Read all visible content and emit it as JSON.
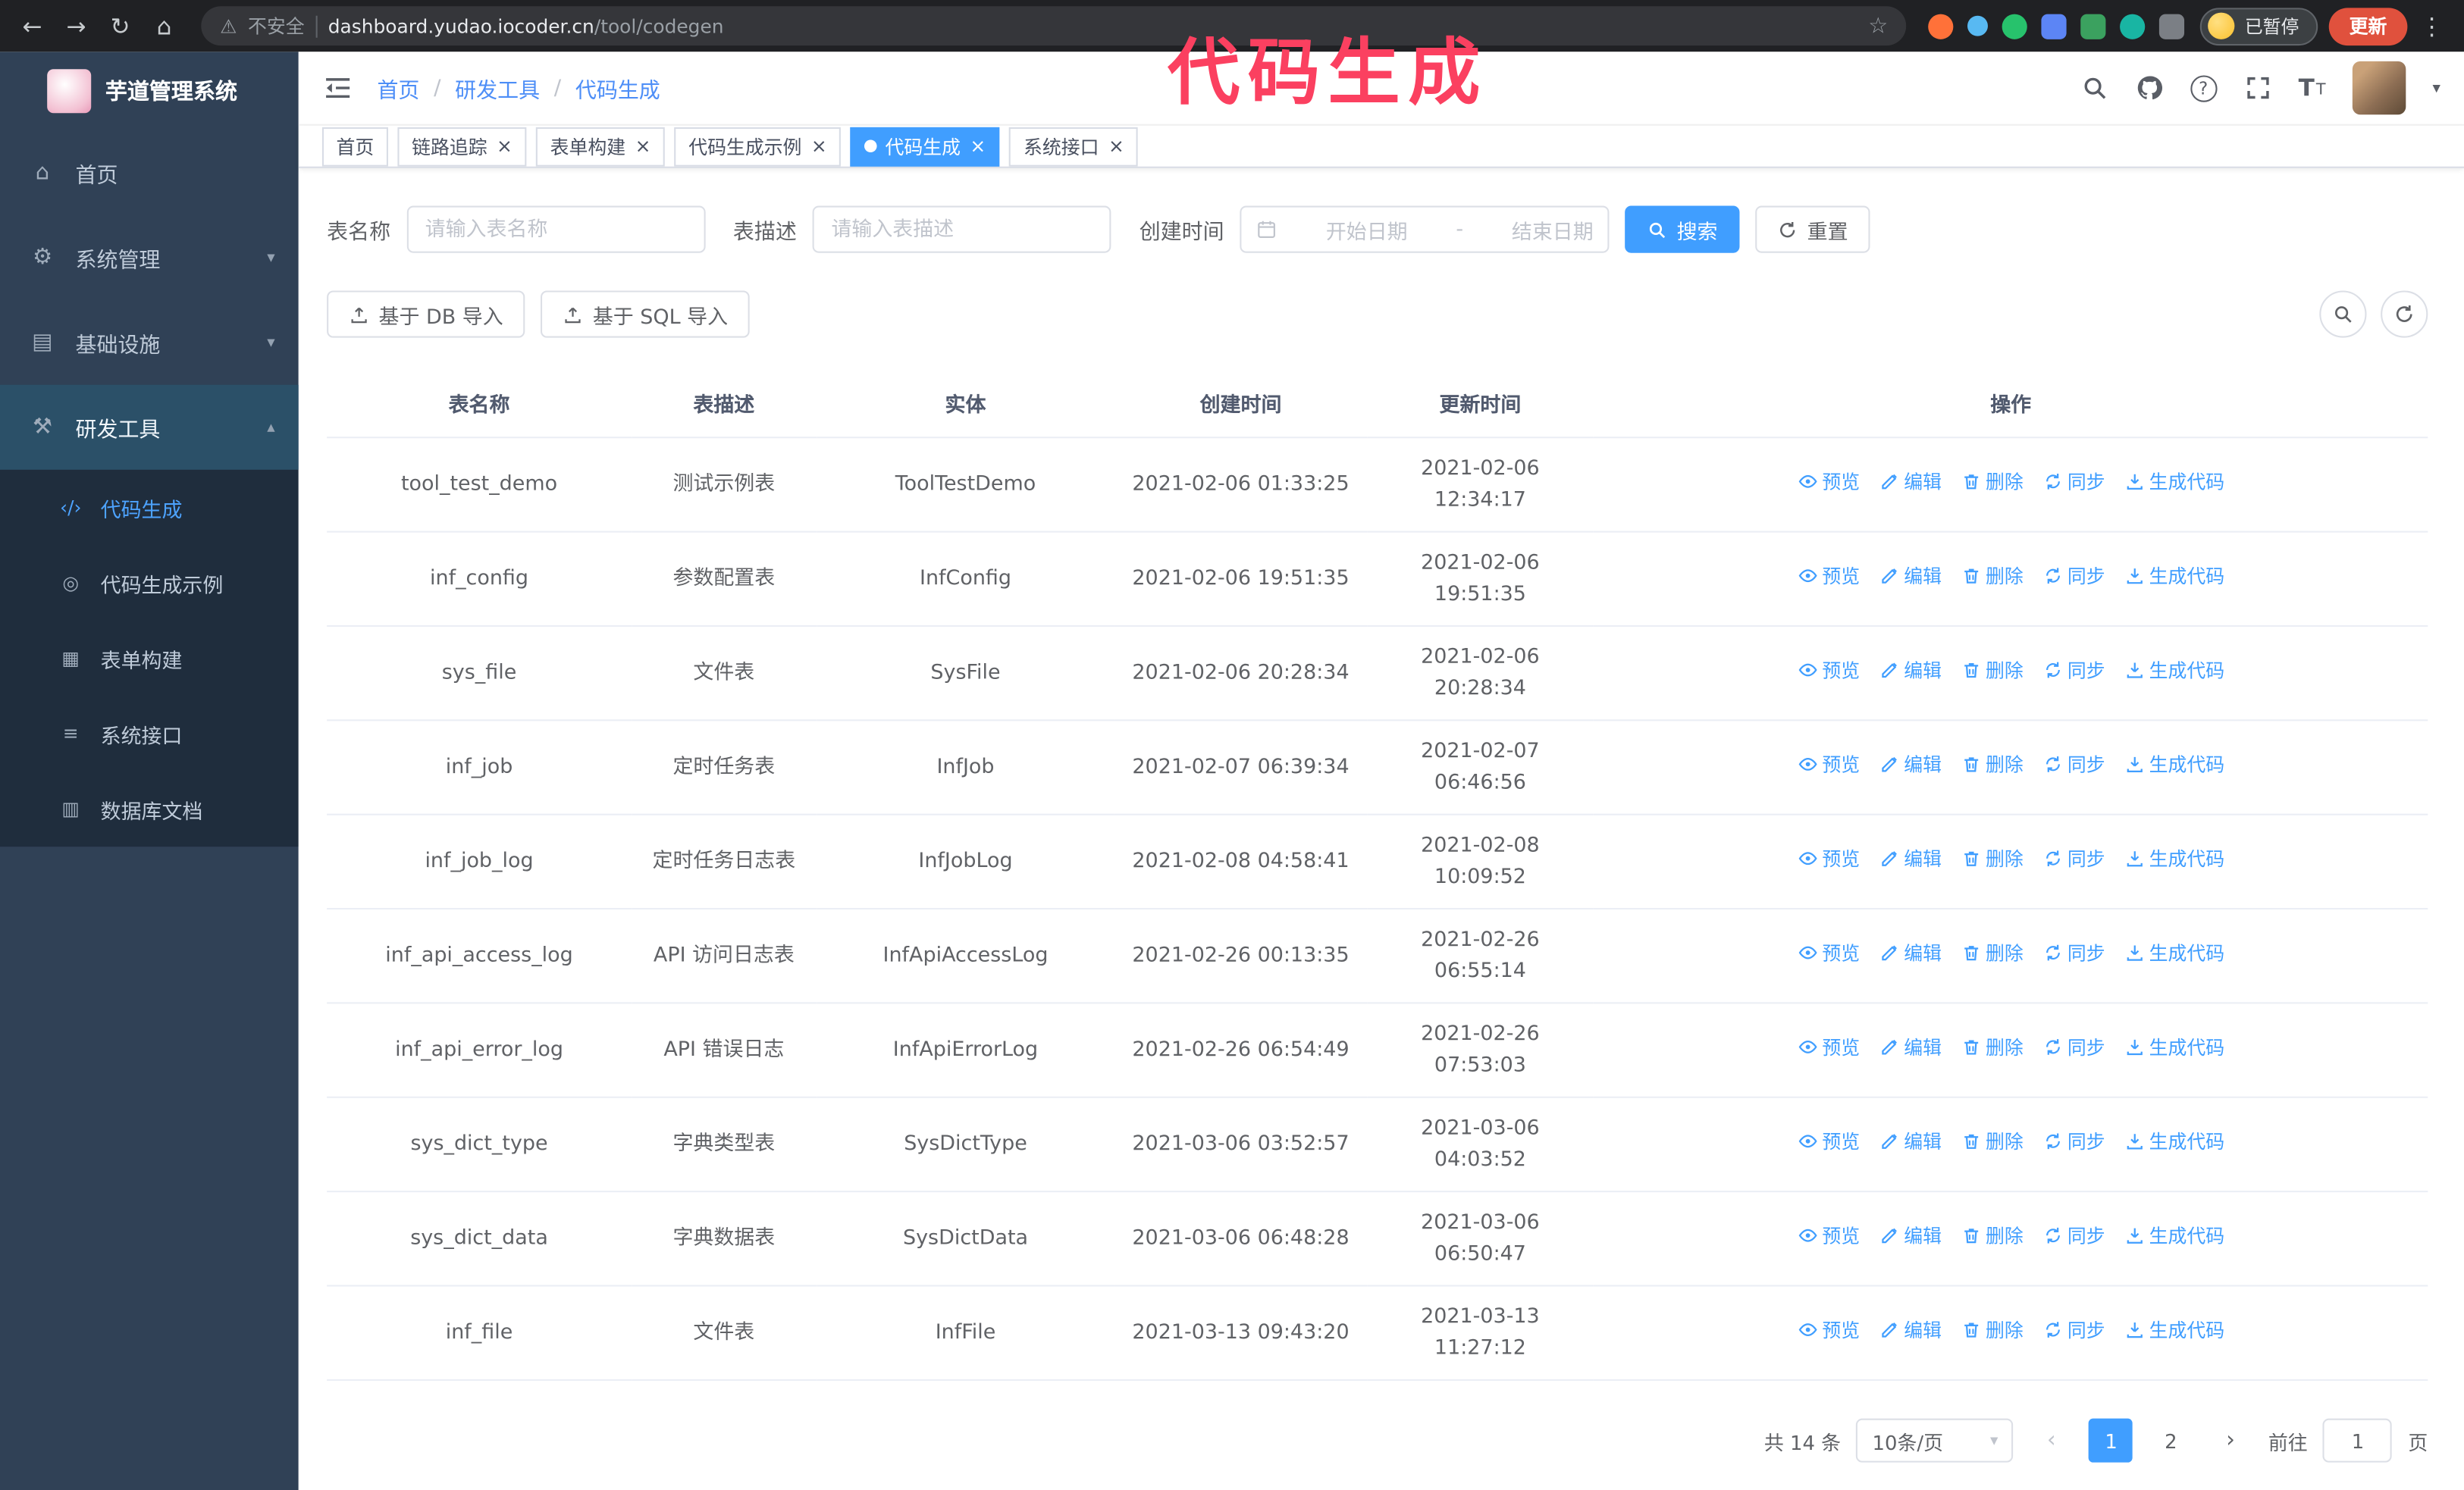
{
  "browser": {
    "security_label": "不安全",
    "url_host": "dashboard.yudao.iocoder.cn",
    "url_path": "/tool/codegen",
    "paused_badge": "已暂停",
    "update_button": "更新"
  },
  "annotation": {
    "text": "代码生成"
  },
  "sidebar": {
    "logo_title": "芋道管理系统",
    "items": [
      {
        "key": "home",
        "label": "首页",
        "icon": "dashboard",
        "expandable": false,
        "expanded": false
      },
      {
        "key": "system",
        "label": "系统管理",
        "icon": "gear",
        "expandable": true,
        "expanded": false
      },
      {
        "key": "infra",
        "label": "基础设施",
        "icon": "server",
        "expandable": true,
        "expanded": false
      },
      {
        "key": "devtools",
        "label": "研发工具",
        "icon": "tool",
        "expandable": true,
        "expanded": true
      }
    ],
    "sub_items": [
      {
        "key": "codegen",
        "label": "代码生成",
        "icon": "code",
        "active": true
      },
      {
        "key": "codegen-example",
        "label": "代码生成示例",
        "icon": "example",
        "active": false
      },
      {
        "key": "form-builder",
        "label": "表单构建",
        "icon": "form",
        "active": false
      },
      {
        "key": "api",
        "label": "系统接口",
        "icon": "api",
        "active": false
      },
      {
        "key": "db-doc",
        "label": "数据库文档",
        "icon": "db",
        "active": false
      }
    ]
  },
  "header": {
    "breadcrumb": [
      "首页",
      "研发工具",
      "代码生成"
    ],
    "separator": "/"
  },
  "tabs": [
    {
      "label": "首页",
      "closable": false,
      "active": false
    },
    {
      "label": "链路追踪",
      "closable": true,
      "active": false
    },
    {
      "label": "表单构建",
      "closable": true,
      "active": false
    },
    {
      "label": "代码生成示例",
      "closable": true,
      "active": false
    },
    {
      "label": "代码生成",
      "closable": true,
      "active": true
    },
    {
      "label": "系统接口",
      "closable": true,
      "active": false
    }
  ],
  "filters": {
    "table_name_label": "表名称",
    "table_name_placeholder": "请输入表名称",
    "table_desc_label": "表描述",
    "table_desc_placeholder": "请输入表描述",
    "create_time_label": "创建时间",
    "date_start_placeholder": "开始日期",
    "date_separator": "-",
    "date_end_placeholder": "结束日期",
    "search_button": "搜索",
    "reset_button": "重置"
  },
  "toolbar": {
    "import_db": "基于 DB 导入",
    "import_sql": "基于 SQL 导入"
  },
  "table": {
    "columns": [
      "表名称",
      "表描述",
      "实体",
      "创建时间",
      "更新时间",
      "操作"
    ],
    "actions": [
      "预览",
      "编辑",
      "删除",
      "同步",
      "生成代码"
    ],
    "rows": [
      {
        "name": "tool_test_demo",
        "desc": "测试示例表",
        "entity": "ToolTestDemo",
        "created": "2021-02-06 01:33:25",
        "updated": "2021-02-06 12:34:17"
      },
      {
        "name": "inf_config",
        "desc": "参数配置表",
        "entity": "InfConfig",
        "created": "2021-02-06 19:51:35",
        "updated": "2021-02-06 19:51:35"
      },
      {
        "name": "sys_file",
        "desc": "文件表",
        "entity": "SysFile",
        "created": "2021-02-06 20:28:34",
        "updated": "2021-02-06 20:28:34"
      },
      {
        "name": "inf_job",
        "desc": "定时任务表",
        "entity": "InfJob",
        "created": "2021-02-07 06:39:34",
        "updated": "2021-02-07 06:46:56"
      },
      {
        "name": "inf_job_log",
        "desc": "定时任务日志表",
        "entity": "InfJobLog",
        "created": "2021-02-08 04:58:41",
        "updated": "2021-02-08 10:09:52"
      },
      {
        "name": "inf_api_access_log",
        "desc": "API 访问日志表",
        "entity": "InfApiAccessLog",
        "created": "2021-02-26 00:13:35",
        "updated": "2021-02-26 06:55:14"
      },
      {
        "name": "inf_api_error_log",
        "desc": "API 错误日志",
        "entity": "InfApiErrorLog",
        "created": "2021-02-26 06:54:49",
        "updated": "2021-02-26 07:53:03"
      },
      {
        "name": "sys_dict_type",
        "desc": "字典类型表",
        "entity": "SysDictType",
        "created": "2021-03-06 03:52:57",
        "updated": "2021-03-06 04:03:52"
      },
      {
        "name": "sys_dict_data",
        "desc": "字典数据表",
        "entity": "SysDictData",
        "created": "2021-03-06 06:48:28",
        "updated": "2021-03-06 06:50:47"
      },
      {
        "name": "inf_file",
        "desc": "文件表",
        "entity": "InfFile",
        "created": "2021-03-13 09:43:20",
        "updated": "2021-03-13 11:27:12"
      }
    ]
  },
  "pagination": {
    "total": "共 14 条",
    "page_size": "10条/页",
    "pages": [
      "1",
      "2"
    ],
    "active_page": "1",
    "goto_label": "前往",
    "goto_value": "1",
    "goto_suffix": "页"
  },
  "colors": {
    "primary": "#409eff",
    "sidebar_bg": "#304156",
    "submenu_bg": "#1f2d3d",
    "annotation": "#fb4060",
    "update_button_bg": "#e0513d"
  }
}
